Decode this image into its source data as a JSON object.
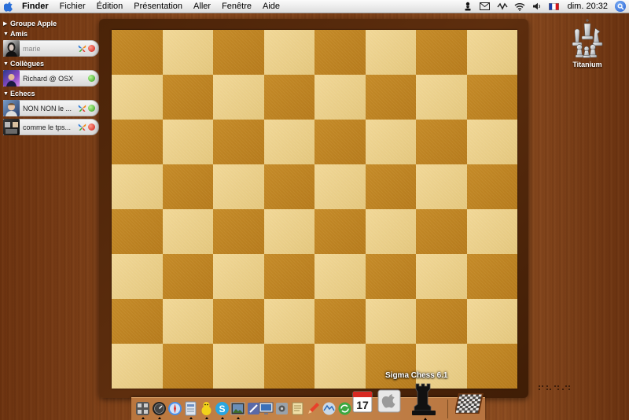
{
  "menubar": {
    "app_name": "Finder",
    "items": [
      "Fichier",
      "Édition",
      "Présentation",
      "Aller",
      "Fenêtre",
      "Aide"
    ],
    "clock": "dim. 20:32"
  },
  "buddy_list": {
    "groups": [
      {
        "name": "Groupe Apple",
        "expanded": false,
        "buddies": []
      },
      {
        "name": "Amis",
        "expanded": true,
        "buddies": [
          {
            "name": "marie",
            "status": "away",
            "idle": true
          }
        ]
      },
      {
        "name": "Collègues",
        "expanded": true,
        "buddies": [
          {
            "name": "Richard @ OSX",
            "status": "online",
            "idle": false
          }
        ]
      },
      {
        "name": "Echecs",
        "expanded": true,
        "buddies": [
          {
            "name": "NON NON le ...",
            "status": "online",
            "idle": false
          },
          {
            "name": "comme le tps...",
            "status": "away",
            "idle": false
          }
        ]
      }
    ]
  },
  "board": {
    "rows": 8,
    "cols": 8,
    "top_left": "dark"
  },
  "desktop_icon": {
    "label": "Titanium",
    "icon": "chess-pieces-icon"
  },
  "dock": {
    "tooltip": "Sigma Chess 6.1",
    "calendar_day": "17"
  },
  "colors": {
    "board_light": "#ebcf88",
    "board_dark": "#be8322",
    "frame": "#4f260b",
    "desktop_wood": "#7a3e16",
    "status_online": "#2ea012",
    "status_away": "#d21a12"
  }
}
